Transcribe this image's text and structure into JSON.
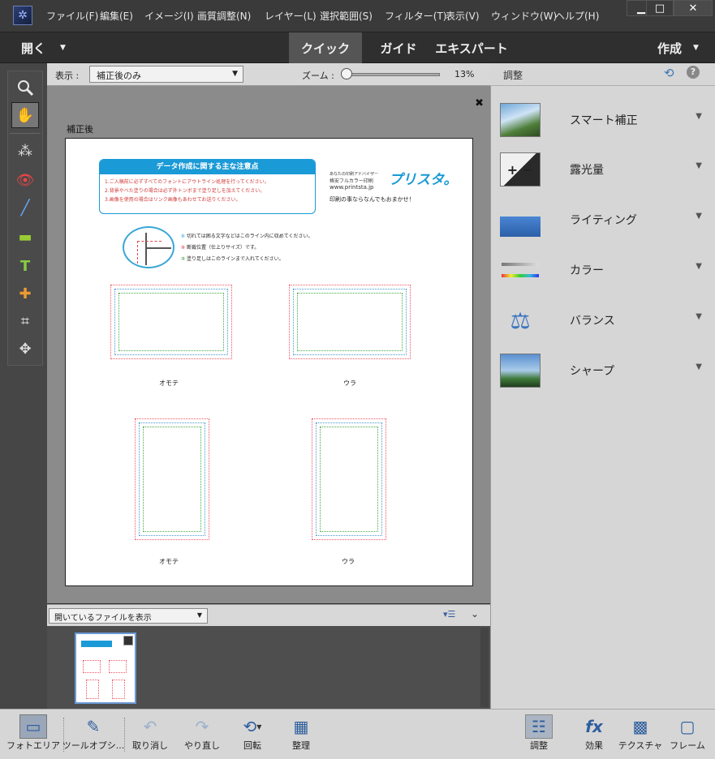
{
  "menu": [
    "ファイル(F)",
    "編集(E)",
    "イメージ(I)",
    "画質調整(N)",
    "レイヤー(L)",
    "選択範囲(S)",
    "フィルター(T)",
    "表示(V)",
    "ウィンドウ(W)",
    "ヘルプ(H)"
  ],
  "window_buttons": {
    "minimize": "▁",
    "maximize": "□",
    "close": "✕"
  },
  "modebar": {
    "open_label": "開く",
    "tabs": [
      "クイック",
      "ガイド",
      "エキスパート"
    ],
    "active_tab": "クイック",
    "create_label": "作成"
  },
  "options": {
    "view_label": "表示 :",
    "view_value": "補正後のみ",
    "zoom_label": "ズーム :",
    "zoom_value": "13%",
    "zoom_level_fraction": 0.0
  },
  "canvas": {
    "caption": "補正後",
    "close_glyph": "✖"
  },
  "document": {
    "box_title": "データ作成に関する主な注意点",
    "notes": [
      "1.ご入稿前に必ずすべてのフォントにアウトライン処理を行ってください。",
      "2.背景やべた塗りの場合は必ず外トンボまで塗り足しを加えてください。",
      "3.画像を使用の場合はリンク画像もあわせてお送りください。"
    ],
    "brand_tagline": "あなたの印刷アドバイザー",
    "brand_sub": "格安フルカラー印刷",
    "brand_url": "www.printsta.jp",
    "brand_logo": "プリスタ。",
    "brand_slogan": "印刷の事ならなんでもおまかせ！",
    "legend": [
      {
        "num": "①",
        "text": "切れては困る文字などはこのライン内に収めてください。"
      },
      {
        "num": "②",
        "text": "断裁位置（仕上りサイズ）です。"
      },
      {
        "num": "③",
        "text": "塗り足しはこのラインまで入れてください。"
      }
    ],
    "legend_colors": [
      "#3aa7d8",
      "#e0444a",
      "#4aa84a"
    ],
    "labels": [
      "オモテ",
      "ウラ",
      "オモテ",
      "ウラ"
    ]
  },
  "adjust_panel": {
    "title": "調整",
    "items": [
      {
        "label": "スマート補正",
        "icon": "smart-fix-icon"
      },
      {
        "label": "露光量",
        "icon": "exposure-icon"
      },
      {
        "label": "ライティング",
        "icon": "lighting-icon"
      },
      {
        "label": "カラー",
        "icon": "color-icon"
      },
      {
        "label": "バランス",
        "icon": "balance-icon"
      },
      {
        "label": "シャープ",
        "icon": "sharpen-icon"
      }
    ]
  },
  "bin": {
    "dropdown": "開いているファイルを表示"
  },
  "bottom": {
    "photo_area": "フォトエリア",
    "tool_options": "ツールオプシ...",
    "undo": "取り消し",
    "redo": "やり直し",
    "rotate": "回転",
    "organize": "整理",
    "adjust": "調整",
    "effects": "効果",
    "textures": "テクスチャ",
    "frames": "フレーム"
  },
  "colors": {
    "accent": "#2d5e9e",
    "brand": "#1a9ad6",
    "note_red": "#d23a3a"
  }
}
